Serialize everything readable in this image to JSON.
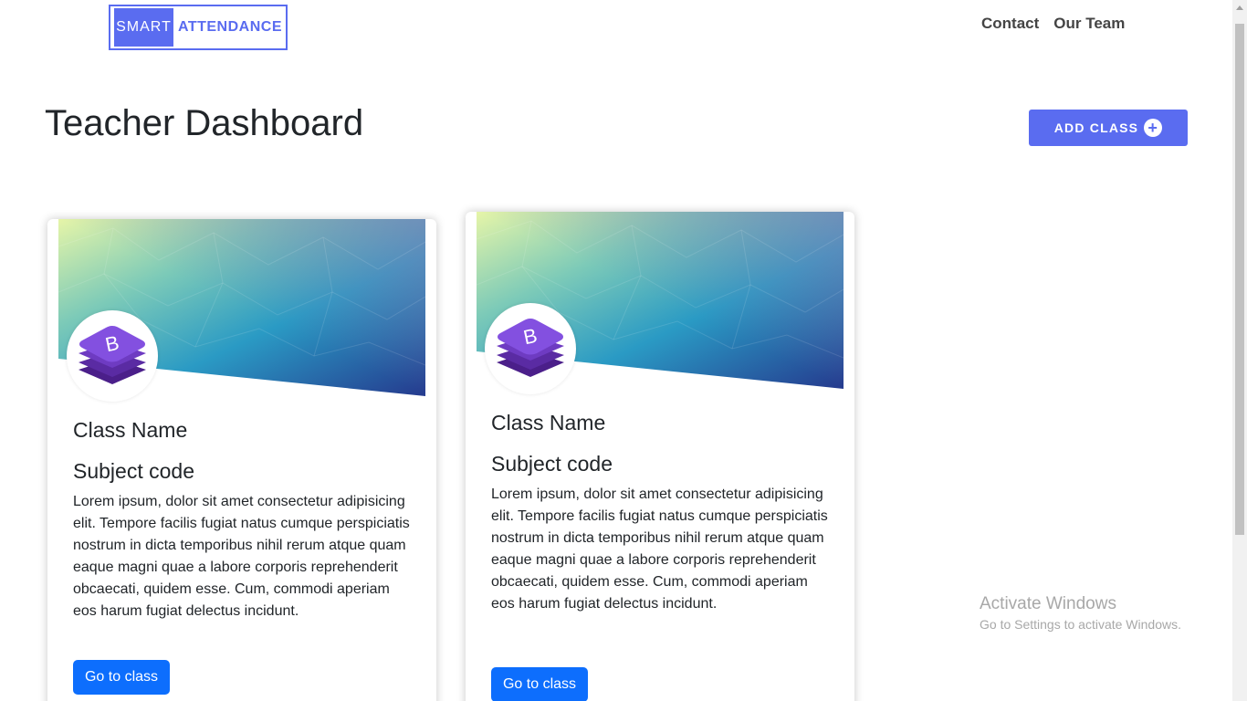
{
  "header": {
    "logo": {
      "part1": "SMART",
      "part2": "ATTENDANCE"
    },
    "nav": [
      {
        "label": "Contact"
      },
      {
        "label": "Our Team"
      }
    ]
  },
  "page": {
    "title": "Teacher Dashboard",
    "add_button": {
      "label": "ADD CLASS",
      "icon": "plus-circle-icon"
    }
  },
  "cards": [
    {
      "title": "Class Name",
      "subtitle": "Subject code",
      "text": "Lorem ipsum, dolor sit amet consectetur adipisicing elit. Tempore facilis fugiat natus cumque perspiciatis nostrum in dicta temporibus nihil rerum atque quam eaque magni quae a labore corporis reprehenderit obcaecati, quidem esse. Cum, commodi aperiam eos harum fugiat delectus incidunt.",
      "button": "Go to class",
      "avatar_letter": "B"
    },
    {
      "title": "Class Name",
      "subtitle": "Subject code",
      "text": "Lorem ipsum, dolor sit amet consectetur adipisicing elit. Tempore facilis fugiat natus cumque perspiciatis nostrum in dicta temporibus nihil rerum atque quam eaque magni quae a labore corporis reprehenderit obcaecati, quidem esse. Cum, commodi aperiam eos harum fugiat delectus incidunt.",
      "button": "Go to class",
      "avatar_letter": "B"
    }
  ],
  "watermark": {
    "title": "Activate Windows",
    "subtitle": "Go to Settings to activate Windows."
  },
  "colors": {
    "brand": "#5a6cf0",
    "primary_button": "#0d6efd",
    "avatar_purple": "#7b3fc4"
  }
}
